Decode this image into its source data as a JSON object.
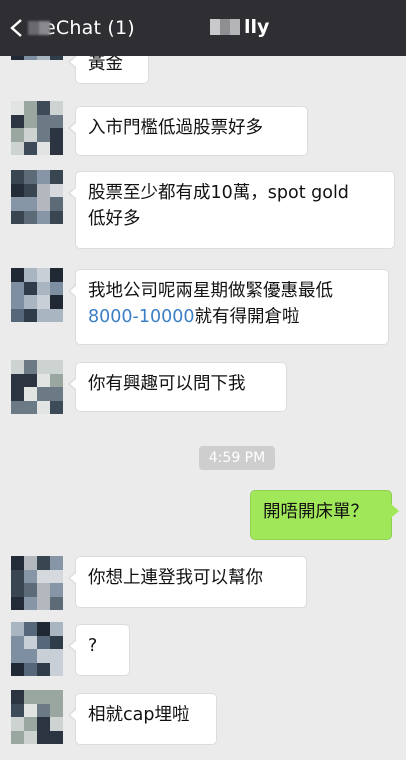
{
  "header": {
    "back_label": "eChat (1)",
    "chat_title": "lly"
  },
  "messages": [
    {
      "text": "黃金"
    },
    {
      "text": "入市門檻低過股票好多"
    },
    {
      "line1": "股票至少都有成10萬，spot gold",
      "line2": "低好多"
    },
    {
      "line1": "我地公司呢兩星期做緊優惠最低",
      "link": "8000-10000",
      "tail": "就有得開倉啦"
    },
    {
      "text": "你有興趣可以問下我"
    },
    {
      "text": "開唔開床單？"
    },
    {
      "text": "你想上連登我可以幫你"
    },
    {
      "text": "?"
    },
    {
      "text": "相就cap埋啦"
    }
  ],
  "timestamp": "4:59 PM",
  "colors": {
    "header_bg": "#2e2e33",
    "chat_bg": "#ebebeb",
    "outgoing_bubble": "#a0e75a",
    "incoming_bubble": "#ffffff",
    "link": "#3d7fc6"
  }
}
